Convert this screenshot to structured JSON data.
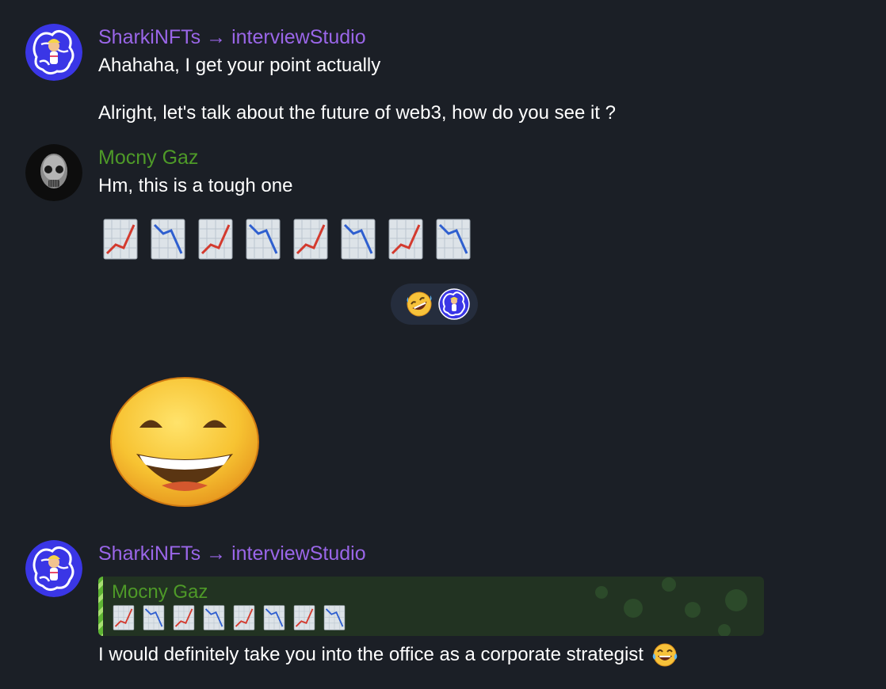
{
  "messages": [
    {
      "sender": "SharkiNFTs → interviewStudio",
      "lines": [
        "Ahahaha, I get your point actually",
        "Alright, let's talk about the future of web3, how do you see it ?"
      ]
    },
    {
      "sender": "Mocny Gaz",
      "lines": [
        "Hm, this is a tough one"
      ],
      "emoji_sequence": [
        "chart-increasing",
        "chart-decreasing",
        "chart-increasing",
        "chart-decreasing",
        "chart-increasing",
        "chart-decreasing",
        "chart-increasing",
        "chart-decreasing"
      ]
    },
    {
      "sticker": "grinning-face"
    },
    {
      "sender": "SharkiNFTs → interviewStudio",
      "reply": {
        "sender": "Mocny Gaz",
        "emoji_sequence": [
          "chart-increasing",
          "chart-decreasing",
          "chart-increasing",
          "chart-decreasing",
          "chart-increasing",
          "chart-decreasing",
          "chart-increasing",
          "chart-decreasing"
        ]
      },
      "text": "I would definitely take you into the office as a corporate strategist",
      "trailing_emoji": "face-with-tears-of-joy"
    }
  ],
  "reactions": [
    {
      "emoji": "rolling-on-the-floor-laughing",
      "reactor": "sharkinfts-avatar"
    }
  ],
  "colors": {
    "background": "#1b1f26",
    "sender_purple": "#9a66e8",
    "sender_green": "#4e9a28",
    "reaction_pill": "#252d3d",
    "reply_box": "#223322",
    "avatar_blue": "#3a36e6"
  }
}
